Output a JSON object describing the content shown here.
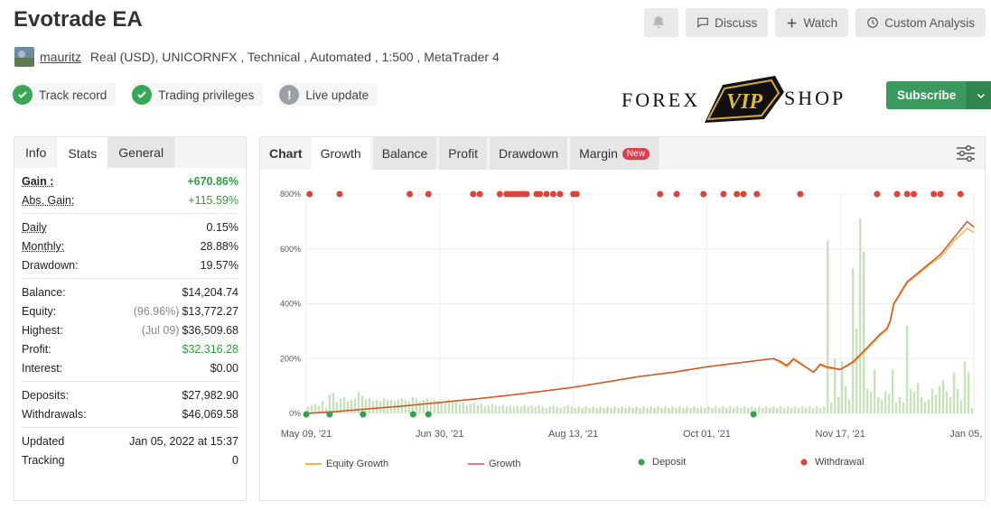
{
  "title": "Evotrade EA",
  "top_buttons": {
    "discuss": "Discuss",
    "watch": "Watch",
    "custom_analysis": "Custom Analysis"
  },
  "user": {
    "name": "mauritz",
    "details": "Real (USD), UNICORNFX , Technical , Automated , 1:500 , MetaTrader 4"
  },
  "badges": {
    "track_record": "Track record",
    "trading_privileges": "Trading privileges",
    "live_update": "Live update"
  },
  "logo": {
    "left": "FOREX",
    "mid": "VIP",
    "right": "SHOP"
  },
  "subscribe": "Subscribe",
  "left_tabs": {
    "info": "Info",
    "stats": "Stats",
    "general": "General"
  },
  "stats": {
    "gain_label": "Gain :",
    "gain": "+670.86%",
    "abs_gain_label": "Abs. Gain:",
    "abs_gain": "+115.59%",
    "daily_label": "Daily",
    "daily": "0.15%",
    "monthly_label": "Monthly:",
    "monthly": "28.88%",
    "drawdown_label": "Drawdown:",
    "drawdown": "19.57%",
    "balance_label": "Balance:",
    "balance": "$14,204.74",
    "equity_label": "Equity:",
    "equity_pct": "(96.96%)",
    "equity": "$13,772.27",
    "highest_label": "Highest:",
    "highest_date": "(Jul 09)",
    "highest": "$36,509.68",
    "profit_label": "Profit:",
    "profit": "$32,316.28",
    "interest_label": "Interest:",
    "interest": "$0.00",
    "deposits_label": "Deposits:",
    "deposits": "$27,982.90",
    "withdrawals_label": "Withdrawals:",
    "withdrawals": "$46,069.58",
    "updated_label": "Updated",
    "updated": "Jan 05, 2022 at 15:37",
    "tracking_label": "Tracking",
    "tracking": "0"
  },
  "chart_tabs": {
    "chart": "Chart",
    "growth": "Growth",
    "balance": "Balance",
    "profit": "Profit",
    "drawdown": "Drawdown",
    "margin": "Margin",
    "new_badge": "New"
  },
  "colors": {
    "growth": "#d2562b",
    "equity": "#f0b64a",
    "deposit": "#2fa24a",
    "withdrawal": "#d9453a",
    "bars": "#c5e3b6"
  },
  "chart_data": {
    "type": "line",
    "y_ticks": [
      "0%",
      "200%",
      "400%",
      "600%",
      "800%"
    ],
    "ylim": [
      0,
      800
    ],
    "x_ticks": [
      "May 09, '21",
      "Jun 30, '21",
      "Aug 13, '21",
      "Oct 01, '21",
      "Nov 17, '21",
      "Jan 05, '22"
    ],
    "grid": true,
    "legend_position": "bottom",
    "legend": [
      "Equity Growth",
      "Growth",
      "Deposit",
      "Withdrawal"
    ],
    "growth_x": [
      0,
      0.05,
      0.1,
      0.15,
      0.2,
      0.25,
      0.3,
      0.35,
      0.4,
      0.45,
      0.5,
      0.55,
      0.6,
      0.65,
      0.7,
      0.71,
      0.72,
      0.73,
      0.76,
      0.77,
      0.78,
      0.8,
      0.82,
      0.84,
      0.86,
      0.87,
      0.875,
      0.88,
      0.9,
      0.92,
      0.94,
      0.95,
      0.96,
      0.97,
      0.98,
      0.99,
      1.0
    ],
    "growth_y": [
      0,
      8,
      18,
      28,
      40,
      52,
      65,
      80,
      95,
      115,
      135,
      150,
      170,
      185,
      200,
      190,
      175,
      200,
      150,
      180,
      170,
      160,
      190,
      240,
      290,
      310,
      340,
      400,
      480,
      520,
      560,
      580,
      610,
      640,
      670,
      700,
      680
    ],
    "equity_y": [
      0,
      8,
      18,
      28,
      40,
      52,
      65,
      80,
      95,
      115,
      135,
      150,
      170,
      185,
      200,
      185,
      170,
      195,
      150,
      175,
      165,
      160,
      185,
      235,
      285,
      305,
      335,
      395,
      475,
      515,
      555,
      570,
      600,
      630,
      650,
      675,
      660
    ],
    "deposit_x": [
      0.0,
      0.035,
      0.085,
      0.16,
      0.183,
      0.67
    ],
    "withdrawal_x": [
      0.005,
      0.05,
      0.155,
      0.183,
      0.25,
      0.26,
      0.29,
      0.3,
      0.305,
      0.31,
      0.315,
      0.32,
      0.325,
      0.33,
      0.345,
      0.35,
      0.36,
      0.37,
      0.38,
      0.4,
      0.405,
      0.53,
      0.555,
      0.595,
      0.625,
      0.645,
      0.655,
      0.675,
      0.74,
      0.855,
      0.885,
      0.9,
      0.91,
      0.94,
      0.95,
      0.98
    ],
    "bars": [
      25,
      30,
      35,
      28,
      45,
      22,
      70,
      75,
      40,
      55,
      60,
      45,
      50,
      55,
      80,
      65,
      50,
      55,
      45,
      50,
      45,
      55,
      50,
      50,
      45,
      50,
      55,
      50,
      45,
      60,
      55,
      45,
      50,
      55,
      45,
      50,
      45,
      40,
      45,
      50,
      45,
      40,
      35,
      40,
      30,
      35,
      40,
      30,
      35,
      25,
      30,
      35,
      30,
      25,
      30,
      25,
      30,
      25,
      30,
      25,
      30,
      25,
      30,
      25,
      30,
      25,
      20,
      25,
      30,
      25,
      20,
      25,
      30,
      25,
      20,
      25,
      20,
      25,
      20,
      25,
      20,
      25,
      20,
      25,
      20,
      25,
      20,
      25,
      20,
      25,
      20,
      25,
      20,
      25,
      20,
      25,
      20,
      25,
      20,
      25,
      20,
      25,
      20,
      25,
      20,
      25,
      20,
      25,
      20,
      25,
      20,
      25,
      20,
      25,
      20,
      25,
      20,
      25,
      20,
      25,
      20,
      25,
      20,
      25,
      20,
      25,
      20,
      25,
      20,
      25,
      20,
      25,
      20,
      25,
      20,
      25,
      20,
      25,
      20,
      25,
      20,
      25,
      20,
      25,
      630,
      40,
      200,
      60,
      190,
      100,
      50,
      530,
      310,
      710,
      590,
      90,
      80,
      160,
      60,
      50,
      80,
      70,
      160,
      40,
      60,
      40,
      320,
      90,
      80,
      110,
      60,
      40,
      50,
      90,
      70,
      100,
      120,
      80,
      60,
      150,
      90,
      50,
      190,
      150,
      20
    ]
  }
}
